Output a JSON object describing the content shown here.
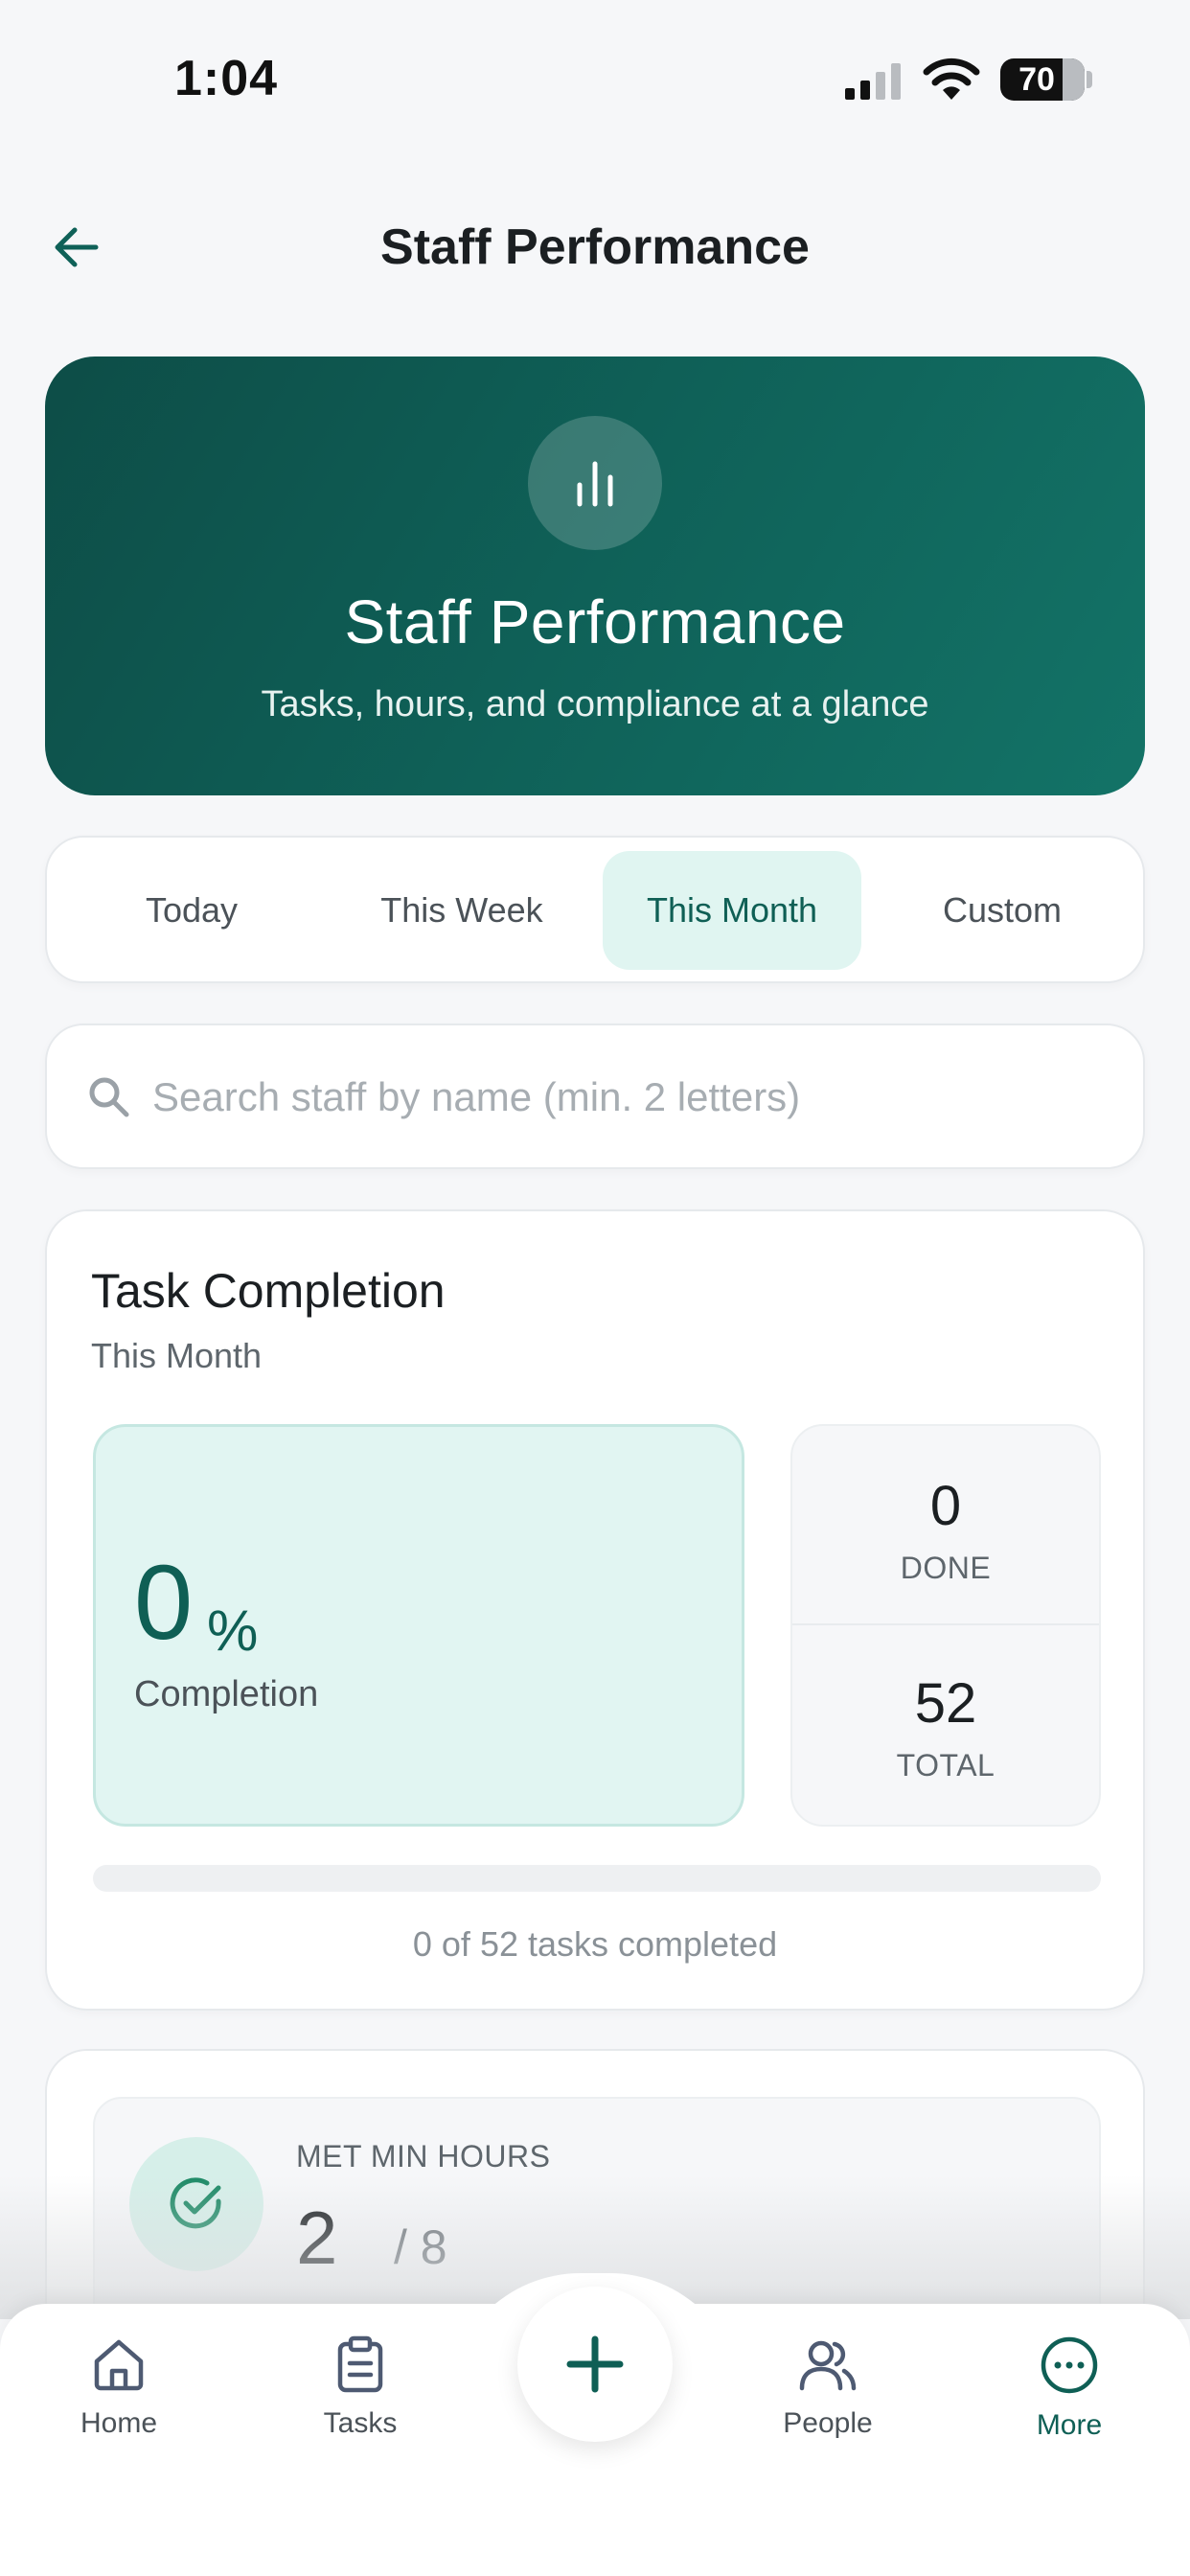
{
  "status_bar": {
    "time": "1:04",
    "battery": "70"
  },
  "header": {
    "title": "Staff Performance"
  },
  "hero": {
    "title": "Staff Performance",
    "subtitle": "Tasks, hours, and compliance at a glance",
    "icon": "bar-chart-icon"
  },
  "tabs": [
    {
      "label": "Today",
      "active": false
    },
    {
      "label": "This Week",
      "active": false
    },
    {
      "label": "This Month",
      "active": true
    },
    {
      "label": "Custom",
      "active": false
    }
  ],
  "search": {
    "placeholder": "Search staff by name (min. 2 letters)",
    "value": ""
  },
  "task_completion": {
    "title": "Task Completion",
    "period": "This Month",
    "percent_value": "0",
    "percent_unit": "%",
    "percent_label": "Completion",
    "done_value": "0",
    "done_label": "DONE",
    "total_value": "52",
    "total_label": "TOTAL",
    "progress_fraction": 0,
    "caption": "0 of 52 tasks completed"
  },
  "hours": {
    "label": "MET MIN HOURS",
    "value": "2",
    "total": "/ 8",
    "icon": "check-circle-icon"
  },
  "nav": {
    "items": [
      {
        "label": "Home",
        "icon": "home-icon",
        "active": false
      },
      {
        "label": "Tasks",
        "icon": "clipboard-icon",
        "active": false
      },
      {
        "label": "People",
        "icon": "people-icon",
        "active": false
      },
      {
        "label": "More",
        "icon": "more-icon",
        "active": true
      }
    ],
    "fab_icon": "plus-icon"
  },
  "colors": {
    "accent": "#0f5f55",
    "hero_gradient_start": "#0d4d47",
    "hero_gradient_end": "#137367",
    "active_tab_bg": "#e0f5f1",
    "background": "#f6f7f9"
  }
}
